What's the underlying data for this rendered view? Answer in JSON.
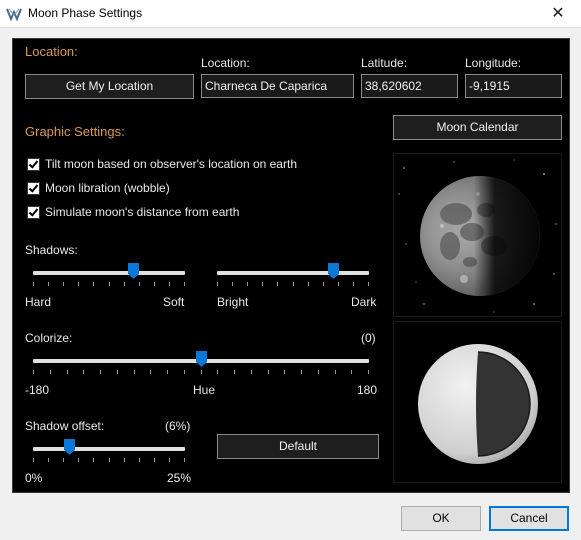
{
  "window": {
    "title": "Moon Phase Settings",
    "close_glyph": "✕",
    "app_icon": "moon-app-icon"
  },
  "location": {
    "section_title": "Location:",
    "get_location_button": "Get My Location",
    "location_label": "Location:",
    "location_value": "Charneca De Caparica",
    "latitude_label": "Latitude:",
    "latitude_value": "38,620602",
    "longitude_label": "Longitude:",
    "longitude_value": "-9,1915"
  },
  "graphic": {
    "section_title": "Graphic Settings:",
    "moon_calendar_button": "Moon Calendar",
    "options": [
      {
        "label": "Tilt moon based on observer's location on earth",
        "checked": true
      },
      {
        "label": "Moon libration (wobble)",
        "checked": true
      },
      {
        "label": "Simulate moon's distance from earth",
        "checked": true
      }
    ]
  },
  "shadows": {
    "label": "Shadows:",
    "slider1": {
      "min_label": "Hard",
      "max_label": "Soft",
      "value": 0.66
    },
    "slider2": {
      "min_label": "Bright",
      "max_label": "Dark",
      "value": 0.76
    }
  },
  "colorize": {
    "label": "Colorize:",
    "value_text": "(0)",
    "min_label": "-180",
    "mid_label": "Hue",
    "max_label": "180",
    "value": 0.5
  },
  "shadow_offset": {
    "label": "Shadow offset:",
    "value_text": "(6%)",
    "min_label": "0%",
    "max_label": "25%",
    "value": 0.24
  },
  "default_button": "Default",
  "footer": {
    "ok": "OK",
    "cancel": "Cancel"
  },
  "colors": {
    "accent": "#d89a55",
    "panel_bg": "#000000",
    "thumb": "#0a78d4"
  }
}
